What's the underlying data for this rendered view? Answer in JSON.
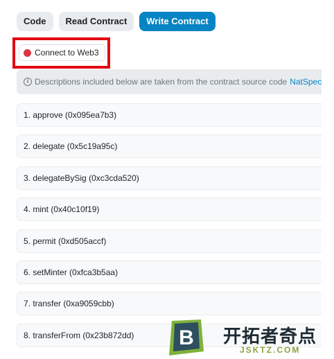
{
  "tabs": [
    {
      "label": "Code",
      "active": false
    },
    {
      "label": "Read Contract",
      "active": false
    },
    {
      "label": "Write Contract",
      "active": true
    }
  ],
  "connect": {
    "label": "Connect to Web3",
    "status_color": "#dc3545",
    "highlight_color": "#e30613"
  },
  "info": {
    "icon": "info-circle-icon",
    "text": "Descriptions included below are taken from the contract source code ",
    "link": "NatSpec",
    "link_suffix": "."
  },
  "functions": [
    "1. approve (0x095ea7b3)",
    "2. delegate (0x5c19a95c)",
    "3. delegateBySig (0xc3cda520)",
    "4. mint (0x40c10f19)",
    "5. permit (0xd505accf)",
    "6. setMinter (0xfca3b5aa)",
    "7. transfer (0xa9059cbb)",
    "8. transferFrom (0x23b872dd)"
  ],
  "watermark": {
    "logo_letter": "B",
    "title": "开拓者奇点",
    "subtitle": "JSKTZ.COM"
  },
  "colors": {
    "accent": "#0784c3",
    "tab_bg": "#e9ecef"
  }
}
